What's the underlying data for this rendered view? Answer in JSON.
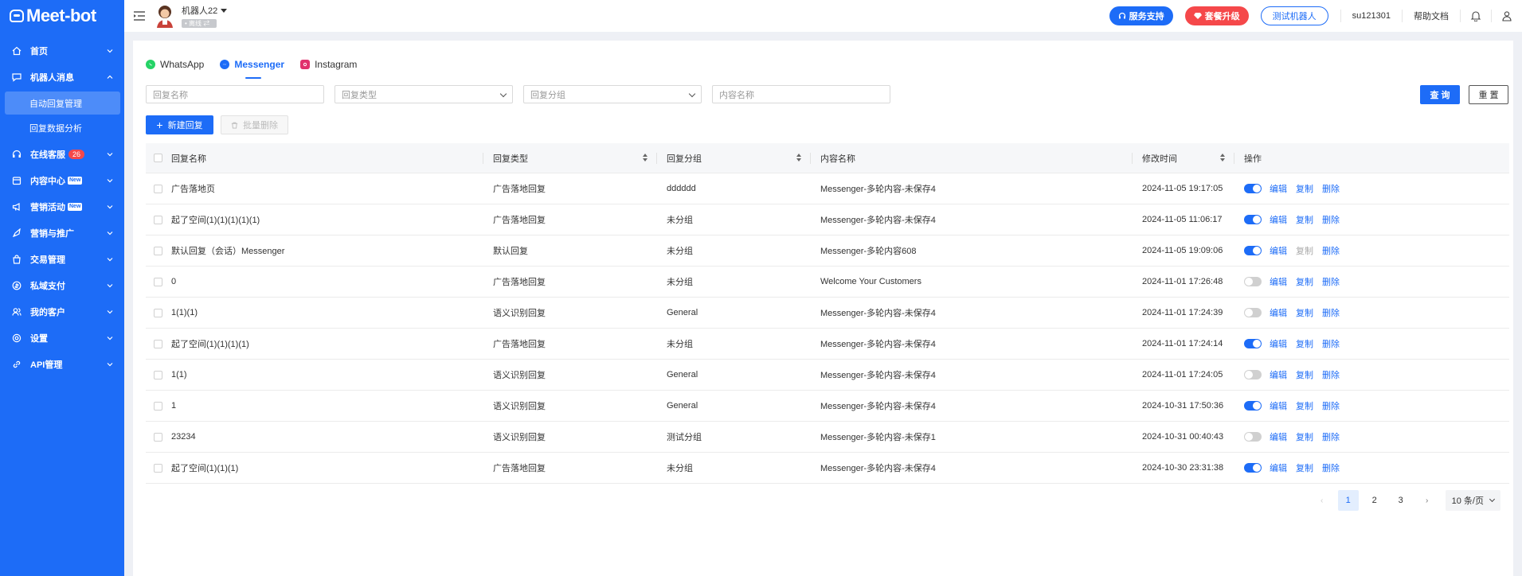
{
  "brand": {
    "logo_text": "Meet-bot"
  },
  "sidebar": {
    "items": [
      {
        "label": "首页",
        "icon": "home-icon"
      },
      {
        "label": "机器人消息",
        "icon": "message-icon",
        "expanded": true,
        "children": [
          {
            "label": "自动回复管理",
            "active": true
          },
          {
            "label": "回复数据分析"
          }
        ]
      },
      {
        "label": "在线客服",
        "icon": "headset-icon",
        "badge": "26"
      },
      {
        "label": "内容中心",
        "icon": "content-icon",
        "tag": "New"
      },
      {
        "label": "营销活动",
        "icon": "megaphone-icon",
        "tag": "New"
      },
      {
        "label": "营销与推广",
        "icon": "rocket-icon"
      },
      {
        "label": "交易管理",
        "icon": "bag-icon"
      },
      {
        "label": "私域支付",
        "icon": "coin-icon"
      },
      {
        "label": "我的客户",
        "icon": "users-icon"
      },
      {
        "label": "设置",
        "icon": "gear-icon"
      },
      {
        "label": "API管理",
        "icon": "link-icon"
      }
    ]
  },
  "topbar": {
    "bot_name": "机器人22",
    "bot_status": "• 离线  ⇄",
    "support_label": "服务支持",
    "upgrade_label": "套餐升级",
    "test_bot_label": "测试机器人",
    "username": "su121301",
    "help_label": "帮助文档"
  },
  "tabs": [
    {
      "label": "WhatsApp",
      "icon": "whatsapp-icon",
      "color": "#25d366"
    },
    {
      "label": "Messenger",
      "icon": "messenger-icon",
      "color": "#1d6cf7",
      "active": true
    },
    {
      "label": "Instagram",
      "icon": "instagram-icon",
      "color": "#e1306c"
    }
  ],
  "filters": {
    "reply_name_placeholder": "回复名称",
    "reply_type_placeholder": "回复类型",
    "reply_group_placeholder": "回复分组",
    "content_name_placeholder": "内容名称",
    "query_label": "查 询",
    "reset_label": "重 置"
  },
  "actions": {
    "new_label": "新建回复",
    "batch_delete_label": "批量删除"
  },
  "table": {
    "columns": [
      "回复名称",
      "回复类型",
      "回复分组",
      "内容名称",
      "修改时间",
      "操作"
    ],
    "rows": [
      {
        "name": "广告落地页",
        "type": "广告落地回复",
        "group": "dddddd",
        "content": "Messenger-多轮内容-未保存4",
        "time": "2024-11-05 19:17:05",
        "enabled": true,
        "copy_disabled": false
      },
      {
        "name": "起了空间(1)(1)(1)(1)(1)",
        "type": "广告落地回复",
        "group": "未分组",
        "content": "Messenger-多轮内容-未保存4",
        "time": "2024-11-05 11:06:17",
        "enabled": true,
        "copy_disabled": false
      },
      {
        "name": "默认回复（会话）Messenger",
        "type": "默认回复",
        "group": "未分组",
        "content": "Messenger-多轮内容608",
        "time": "2024-11-05 19:09:06",
        "enabled": true,
        "copy_disabled": true
      },
      {
        "name": "0",
        "type": "广告落地回复",
        "group": "未分组",
        "content": "Welcome Your Customers",
        "time": "2024-11-01 17:26:48",
        "enabled": false,
        "copy_disabled": false
      },
      {
        "name": "1(1)(1)",
        "type": "语义识别回复",
        "group": "General",
        "content": "Messenger-多轮内容-未保存4",
        "time": "2024-11-01 17:24:39",
        "enabled": false,
        "copy_disabled": false
      },
      {
        "name": "起了空间(1)(1)(1)(1)",
        "type": "广告落地回复",
        "group": "未分组",
        "content": "Messenger-多轮内容-未保存4",
        "time": "2024-11-01 17:24:14",
        "enabled": true,
        "copy_disabled": false
      },
      {
        "name": "1(1)",
        "type": "语义识别回复",
        "group": "General",
        "content": "Messenger-多轮内容-未保存4",
        "time": "2024-11-01 17:24:05",
        "enabled": false,
        "copy_disabled": false
      },
      {
        "name": "1",
        "type": "语义识别回复",
        "group": "General",
        "content": "Messenger-多轮内容-未保存4",
        "time": "2024-10-31 17:50:36",
        "enabled": true,
        "copy_disabled": false
      },
      {
        "name": "23234",
        "type": "语义识别回复",
        "group": "测试分组",
        "content": "Messenger-多轮内容-未保存1",
        "time": "2024-10-31 00:40:43",
        "enabled": false,
        "copy_disabled": false
      },
      {
        "name": "起了空间(1)(1)(1)",
        "type": "广告落地回复",
        "group": "未分组",
        "content": "Messenger-多轮内容-未保存4",
        "time": "2024-10-30 23:31:38",
        "enabled": true,
        "copy_disabled": false
      }
    ],
    "op_labels": {
      "edit": "编辑",
      "copy": "复制",
      "delete": "删除"
    }
  },
  "pagination": {
    "pages": [
      "1",
      "2",
      "3"
    ],
    "current": "1",
    "prev": "‹",
    "next": "›",
    "page_size": "10 条/页"
  },
  "colors": {
    "primary": "#1d6cf7",
    "danger": "#f5484a",
    "sidebar": "#1d6cf7"
  }
}
